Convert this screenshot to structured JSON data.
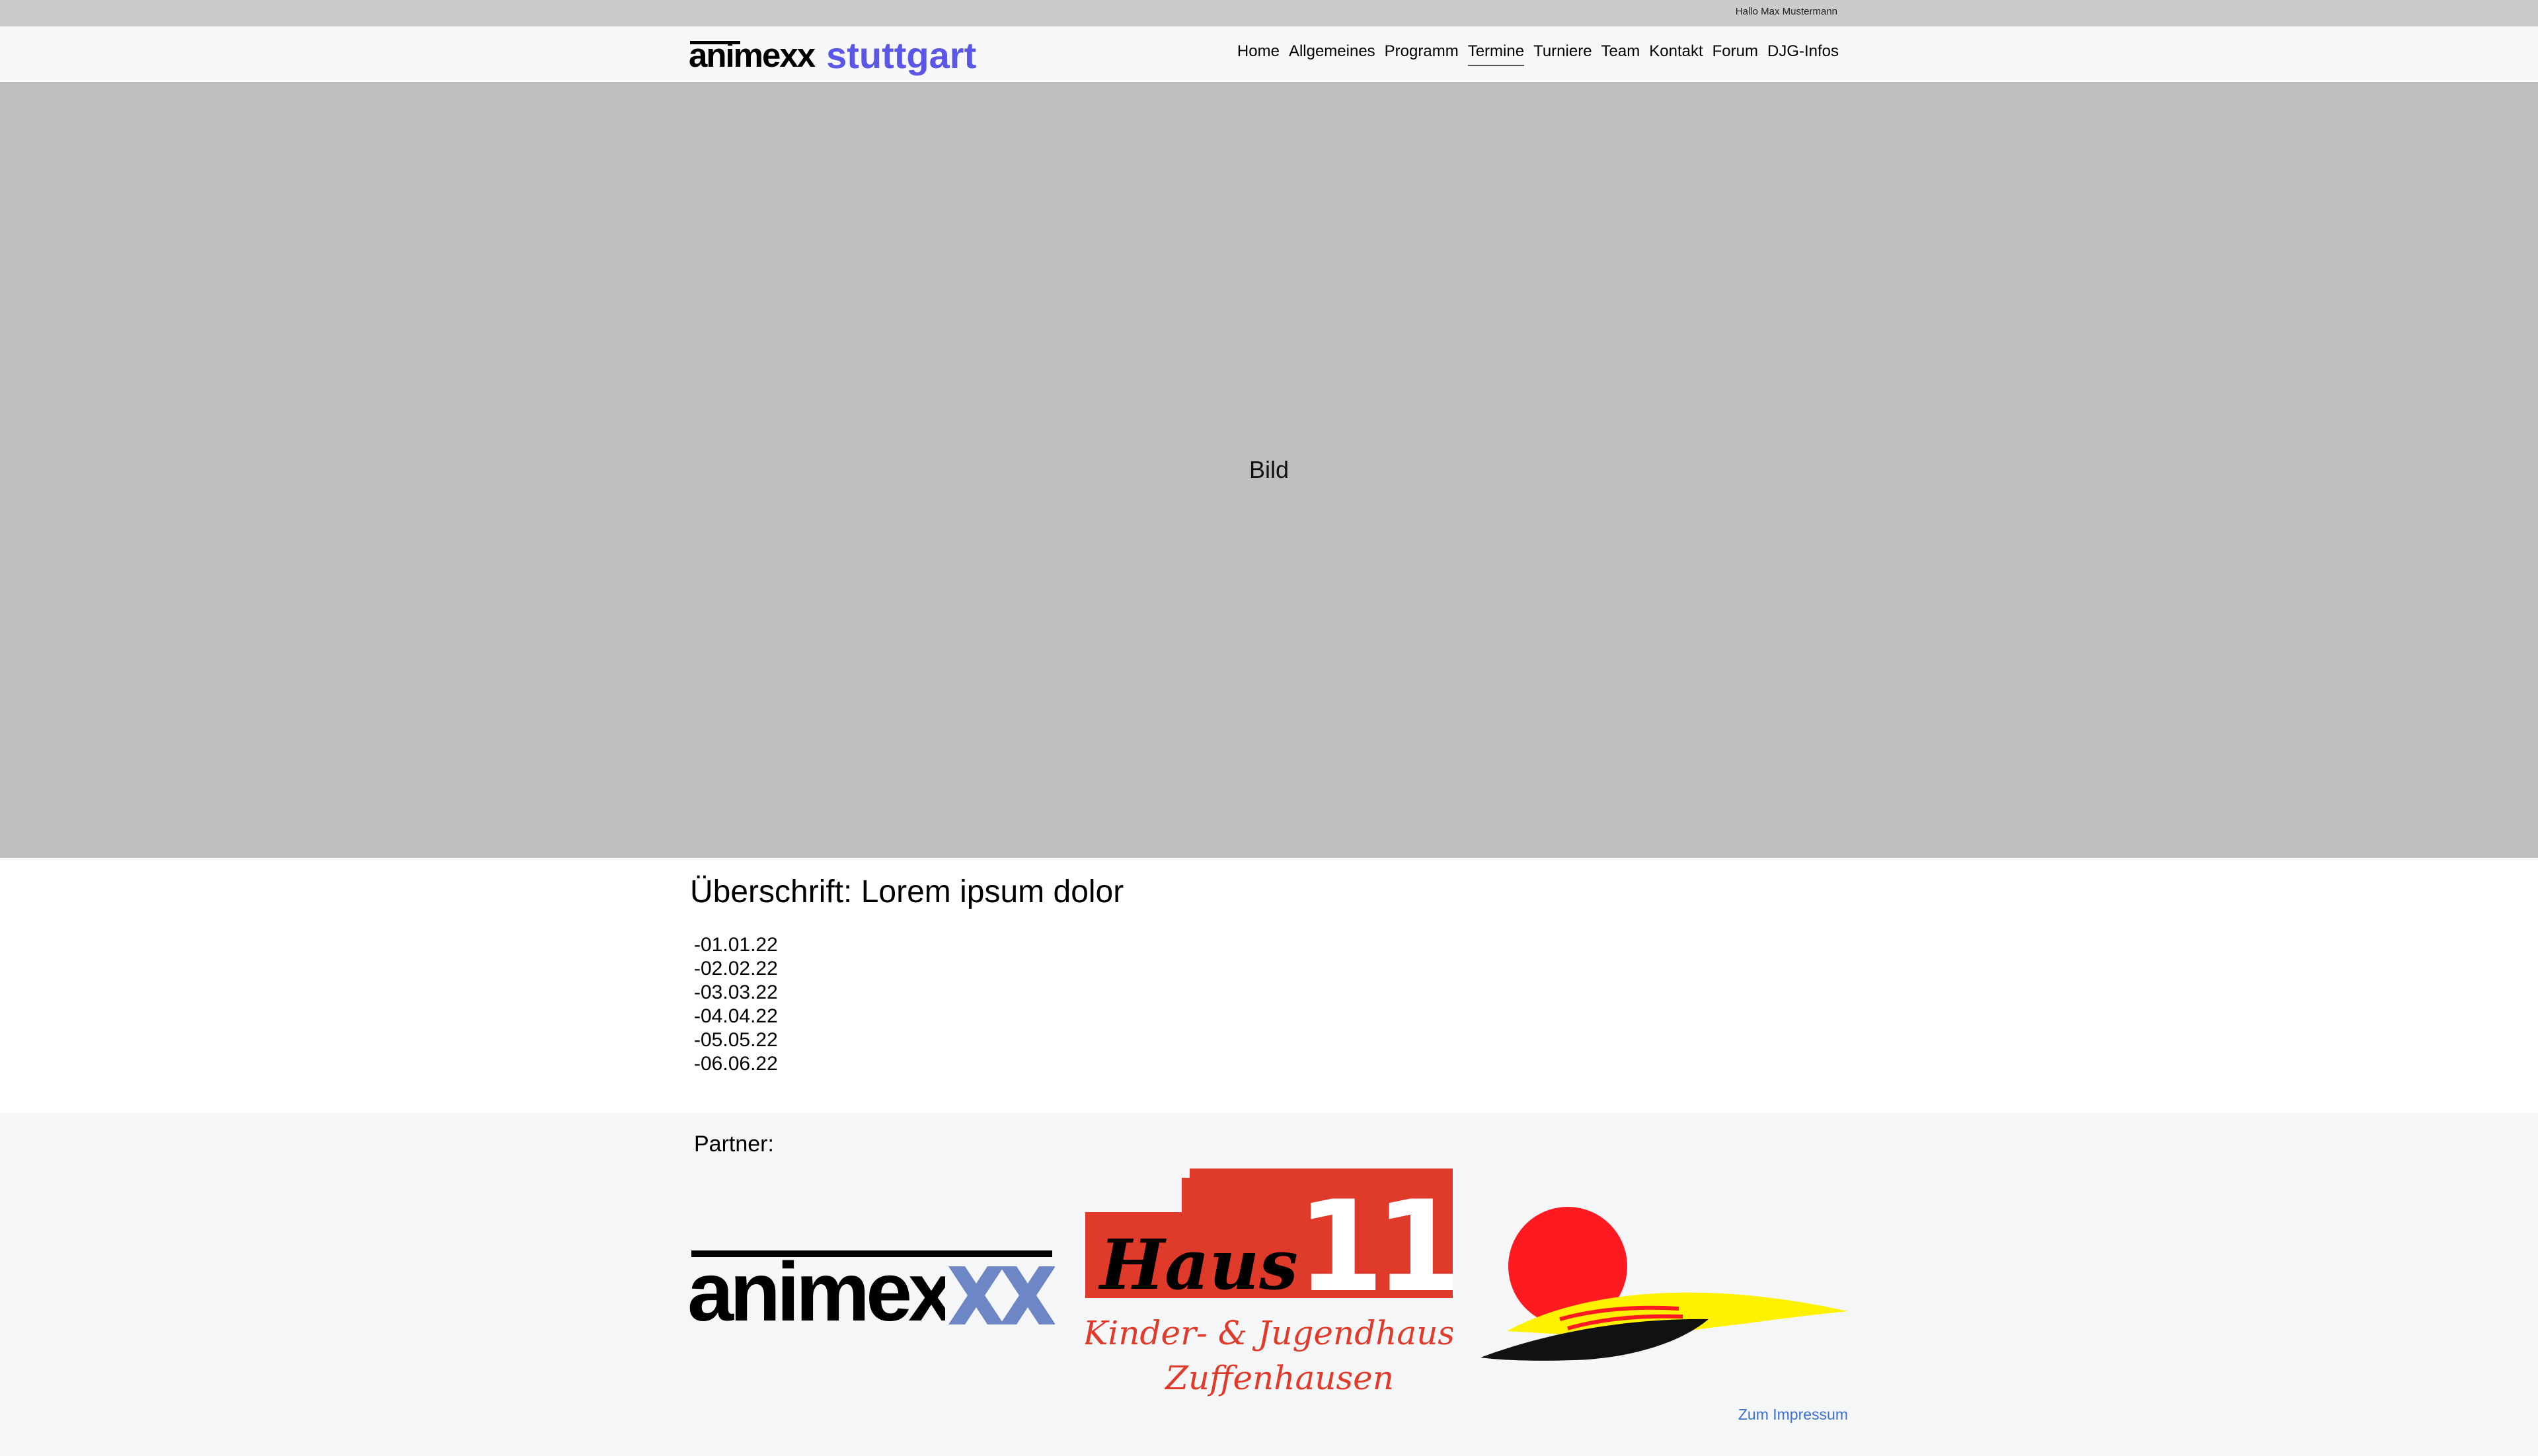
{
  "topbar": {
    "greeting": "Hallo Max Mustermann"
  },
  "header": {
    "brand": {
      "name": "animexx",
      "city": "stuttgart"
    },
    "nav": [
      {
        "label": "Home"
      },
      {
        "label": "Allgemeines"
      },
      {
        "label": "Programm"
      },
      {
        "label": "Termine",
        "active": true
      },
      {
        "label": "Turniere"
      },
      {
        "label": "Team"
      },
      {
        "label": "Kontakt"
      },
      {
        "label": "Forum"
      },
      {
        "label": "DJG-Infos"
      }
    ]
  },
  "hero": {
    "label": "Bild"
  },
  "main": {
    "heading": "Überschrift: Lorem ipsum dolor",
    "dates": [
      "-01.01.22",
      "-02.02.22",
      "-03.03.22",
      "-04.04.22",
      "-05.05.22",
      "-06.06.22"
    ]
  },
  "footer": {
    "partner_label": "Partner:",
    "partners": {
      "animexx": {
        "text": "animexx"
      },
      "haus11": {
        "title": "Haus",
        "number": "11",
        "line1": "Kinder- & Jugendhaus",
        "line2": "Zuffenhausen"
      }
    },
    "impressum": "Zum Impressum"
  },
  "colors": {
    "brand": "#5a56e6",
    "hero": "#bfbfbf",
    "haus_red": "#e03a2a",
    "sun_red": "#ff1a22",
    "sun_yellow": "#fff200",
    "link": "#3b6fd1"
  }
}
